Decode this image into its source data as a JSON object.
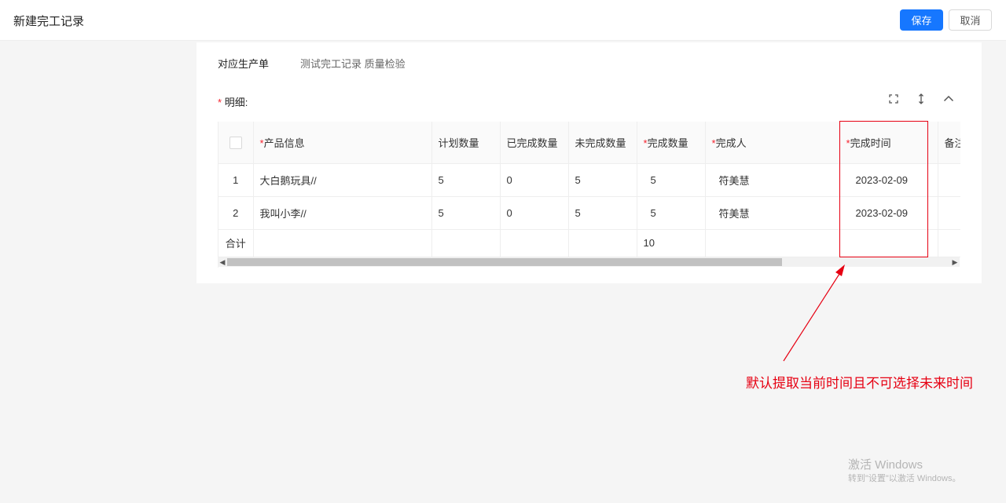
{
  "header": {
    "title": "新建完工记录",
    "save_label": "保存",
    "cancel_label": "取消"
  },
  "form": {
    "order_label": "对应生产单",
    "order_value": "测试完工记录 质量检验"
  },
  "detail": {
    "required_mark": "*",
    "label": "明细:"
  },
  "toolbar": {
    "fullscreen_icon": "fullscreen-icon",
    "density_icon": "vertical-arrows-icon",
    "collapse_icon": "chevron-up-icon"
  },
  "table": {
    "columns": [
      {
        "label": "",
        "required": false
      },
      {
        "label": "产品信息",
        "required": true
      },
      {
        "label": "计划数量",
        "required": false
      },
      {
        "label": "已完成数量",
        "required": false
      },
      {
        "label": "未完成数量",
        "required": false
      },
      {
        "label": "完成数量",
        "required": true
      },
      {
        "label": "完成人",
        "required": true
      },
      {
        "label": "完成时间",
        "required": true
      },
      {
        "label": "备注",
        "required": false
      }
    ],
    "required_mark": "*",
    "rows": [
      {
        "index": "1",
        "product": "大白鹅玩具//",
        "planned": "5",
        "completed": "0",
        "uncompleted": "5",
        "finish_qty": "5",
        "finisher": "符美慧",
        "finish_time": "2023-02-09",
        "remark": ""
      },
      {
        "index": "2",
        "product": "我叫小李//",
        "planned": "5",
        "completed": "0",
        "uncompleted": "5",
        "finish_qty": "5",
        "finisher": "符美慧",
        "finish_time": "2023-02-09",
        "remark": ""
      }
    ],
    "summary": {
      "label": "合计",
      "finish_qty_total": "10"
    }
  },
  "annotation": {
    "text": "默认提取当前时间且不可选择未来时间",
    "color": "#e60012"
  },
  "watermark": {
    "line1": "激活 Windows",
    "line2": "转到\"设置\"以激活 Windows。"
  },
  "colors": {
    "primary": "#1677ff",
    "required": "#f5222d"
  }
}
